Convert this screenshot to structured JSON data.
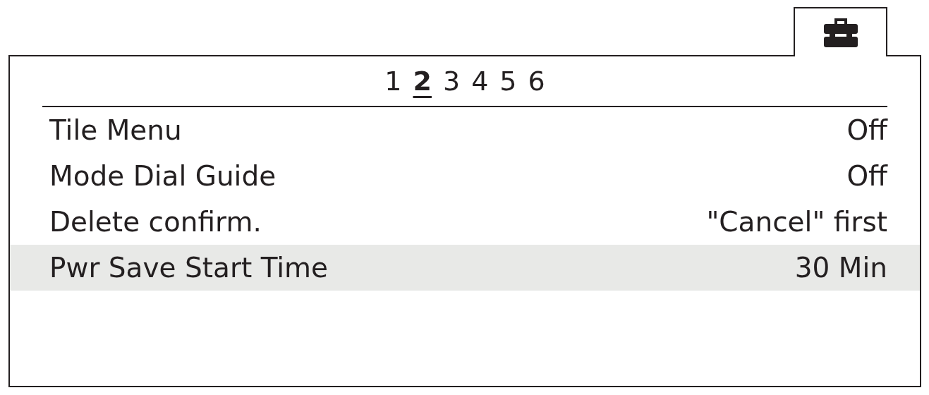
{
  "tabs": [
    {
      "kind": "toolbox",
      "selected": true
    }
  ],
  "pages": [
    {
      "label": "1",
      "selected": false
    },
    {
      "label": "2",
      "selected": true
    },
    {
      "label": "3",
      "selected": false
    },
    {
      "label": "4",
      "selected": false
    },
    {
      "label": "5",
      "selected": false
    },
    {
      "label": "6",
      "selected": false
    }
  ],
  "items": [
    {
      "label": "Tile Menu",
      "value": "Off",
      "selected": false
    },
    {
      "label": "Mode Dial Guide",
      "value": "Off",
      "selected": false
    },
    {
      "label": "Delete confirm.",
      "value": "\"Cancel\" first",
      "selected": false
    },
    {
      "label": "Pwr Save Start Time",
      "value": "30 Min",
      "selected": true
    }
  ]
}
